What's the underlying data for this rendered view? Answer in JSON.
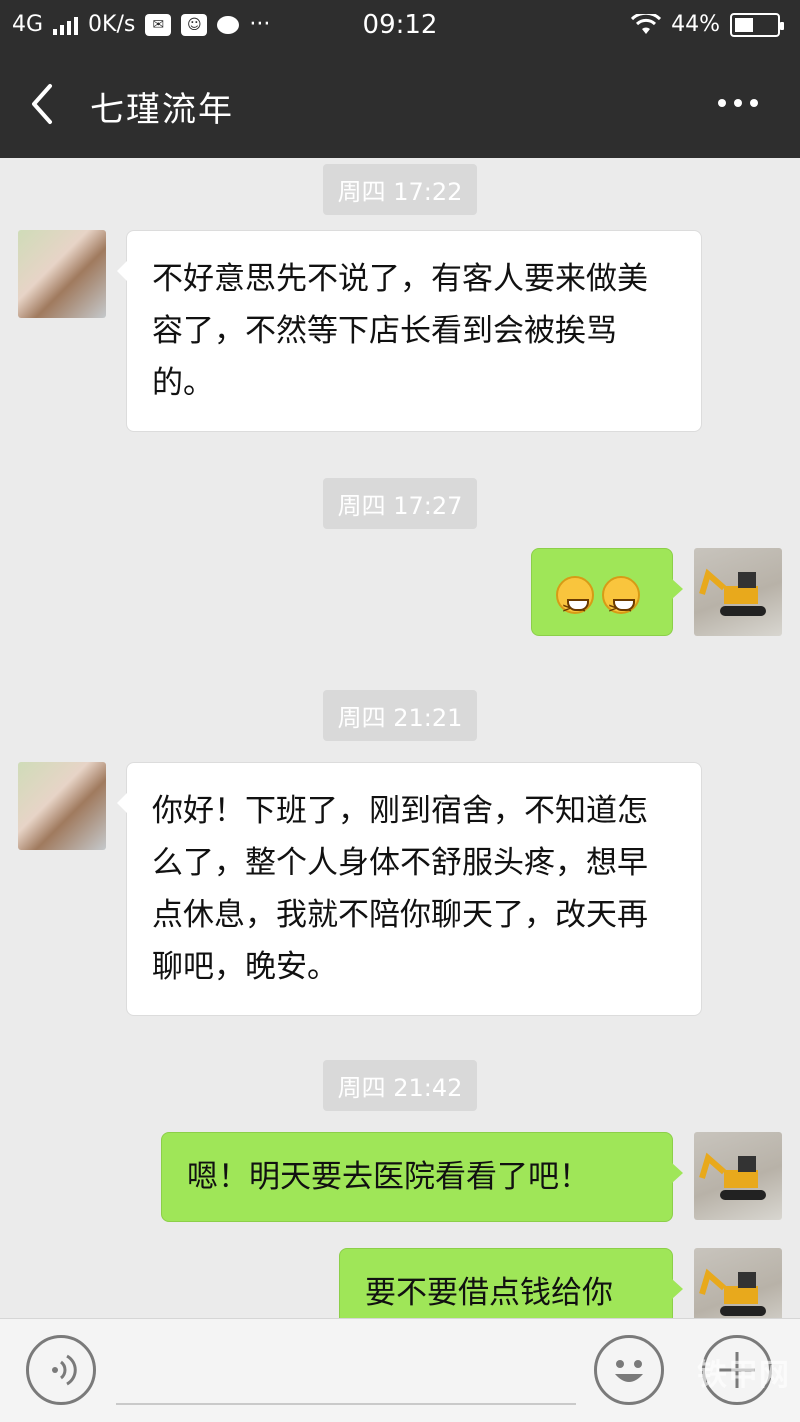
{
  "status_bar": {
    "network": "4G",
    "speed": "0K/s",
    "time": "09:12",
    "battery": "44%",
    "more": "···"
  },
  "header": {
    "title": "七瑾流年"
  },
  "messages": [
    {
      "type": "time",
      "text": "周四 17:22"
    },
    {
      "type": "in",
      "text": "不好意思先不说了，有客人要来做美容了，不然等下店长看到会被挨骂的。"
    },
    {
      "type": "time",
      "text": "周四 17:27"
    },
    {
      "type": "out",
      "emoji": [
        "grinning-face-emoji",
        "grinning-face-emoji"
      ]
    },
    {
      "type": "time",
      "text": "周四 21:21"
    },
    {
      "type": "in",
      "text": "你好！下班了，刚到宿舍，不知道怎么了，整个人身体不舒服头疼，想早点休息，我就不陪你聊天了，改天再聊吧，晚安。"
    },
    {
      "type": "time",
      "text": "周四 21:42"
    },
    {
      "type": "out",
      "text": "嗯！明天要去医院看看了吧！"
    },
    {
      "type": "out",
      "text": "要不要借点钱给你"
    }
  ],
  "input_bar": {
    "icons": [
      "voice-icon",
      "emoji-icon",
      "plus-icon"
    ]
  },
  "watermark": "铁甲网",
  "colors": {
    "header_bg": "#2e2e2e",
    "chat_bg": "#ebebeb",
    "outgoing_bubble": "#9fe658",
    "incoming_bubble": "#ffffff"
  }
}
